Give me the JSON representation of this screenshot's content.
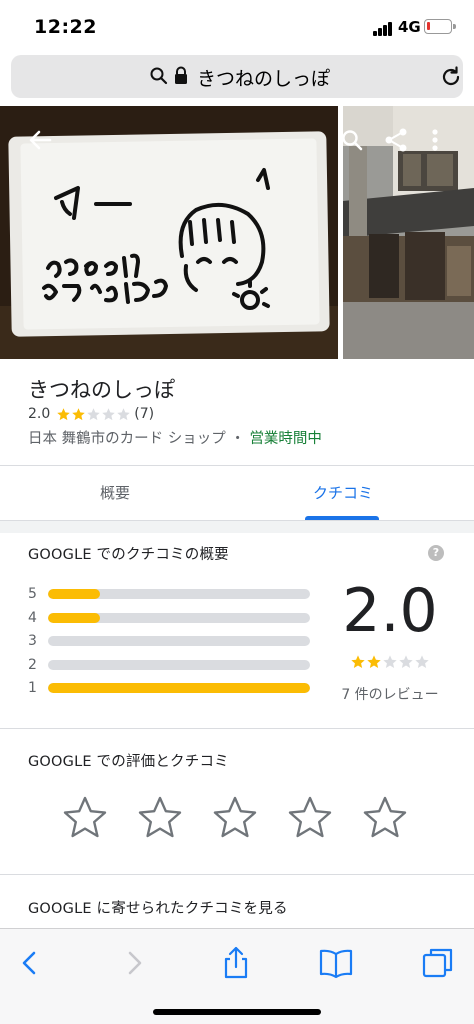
{
  "status_bar": {
    "time": "12:22",
    "network": "4G",
    "battery_level": 0.15
  },
  "url_bar": {
    "url_text": "きつねのしっぽ"
  },
  "place": {
    "title": "きつねのしっぽ",
    "rating": "2.0",
    "rating_value": 2,
    "rating_count": "(7)",
    "meta": "日本 舞鶴市のカード ショップ ・ ",
    "open_status": "営業時間中"
  },
  "tabs": [
    {
      "label": "概要",
      "active": false
    },
    {
      "label": "クチコミ",
      "active": true
    }
  ],
  "review_summary": {
    "heading": "GOOGLE でのクチコミの概要",
    "help_icon": "?",
    "distribution": [
      {
        "stars": "5",
        "fraction": 0.2
      },
      {
        "stars": "4",
        "fraction": 0.2
      },
      {
        "stars": "3",
        "fraction": 0.0
      },
      {
        "stars": "2",
        "fraction": 0.0
      },
      {
        "stars": "1",
        "fraction": 1.0
      }
    ],
    "average": "2.0",
    "average_stars": 2,
    "count_label": "7 件のレビュー"
  },
  "rate_section": {
    "heading": "GOOGLE での評価とクチコミ",
    "star_count": 5
  },
  "more_reviews": {
    "heading": "GOOGLE に寄せられたクチコミを見る"
  },
  "colors": {
    "accent": "#1a73e8",
    "star_filled": "#fbbc04",
    "star_empty": "#dadce0",
    "open_green": "#188038",
    "ios_blue": "#1a7cf5"
  },
  "icons": {
    "url_search": "search-icon",
    "url_lock": "lock-icon",
    "reload": "reload-icon",
    "back": "arrow-left-icon",
    "photo_search": "search-icon",
    "share": "share-icon",
    "more": "more-vert-icon",
    "toolbar_back": "chevron-left-icon",
    "toolbar_forward": "chevron-right-icon",
    "toolbar_share": "share-up-icon",
    "toolbar_bookmarks": "book-icon",
    "toolbar_tabs": "tabs-icon"
  }
}
